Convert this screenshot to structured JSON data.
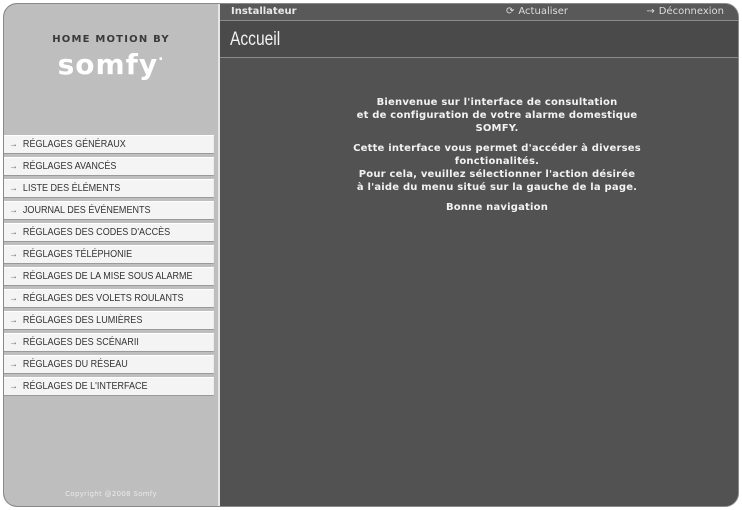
{
  "brand": {
    "tagline": "HOME MOTION BY",
    "logo": "somfy",
    "logo_mark": "."
  },
  "sidebar": {
    "items": [
      {
        "label": "RÉGLAGES GÉNÉRAUX"
      },
      {
        "label": "RÉGLAGES AVANCÉS"
      },
      {
        "label": "LISTE DES ÉLÉMENTS"
      },
      {
        "label": "JOURNAL DES ÉVÉNEMENTS"
      },
      {
        "label": "RÉGLAGES DES CODES D'ACCÈS"
      },
      {
        "label": "RÉGLAGES TÉLÉPHONIE"
      },
      {
        "label": "RÉGLAGES DE LA MISE SOUS ALARME"
      },
      {
        "label": "RÉGLAGES DES VOLETS ROULANTS"
      },
      {
        "label": "RÉGLAGES DES LUMIÈRES"
      },
      {
        "label": "RÉGLAGES DES SCÉNARII"
      },
      {
        "label": "RÉGLAGES DU RÉSEAU"
      },
      {
        "label": "RÉGLAGES DE L'INTERFACE"
      }
    ],
    "copyright": "Copyright @2008 Somfy"
  },
  "header": {
    "role": "Installateur",
    "refresh_label": "Actualiser",
    "logout_label": "Déconnexion",
    "page_title": "Accueil"
  },
  "main": {
    "welcome_lines": [
      "Bienvenue sur l'interface de consultation",
      "et de configuration de votre alarme domestique",
      "SOMFY.",
      "Cette interface vous permet d'accéder à diverses",
      "fonctionalités.",
      "Pour cela, veuillez sélectionner l'action désirée",
      "à l'aide du menu situé sur la gauche de la page.",
      "Bonne navigation"
    ]
  },
  "icons": {
    "menu_arrow": "arrow-right-icon",
    "refresh": "refresh-icon",
    "logout": "arrow-right-icon"
  },
  "colors": {
    "sidebar_bg": "#bebebe",
    "content_bg": "#525252",
    "menu_item_bg": "#f4f4f4"
  }
}
